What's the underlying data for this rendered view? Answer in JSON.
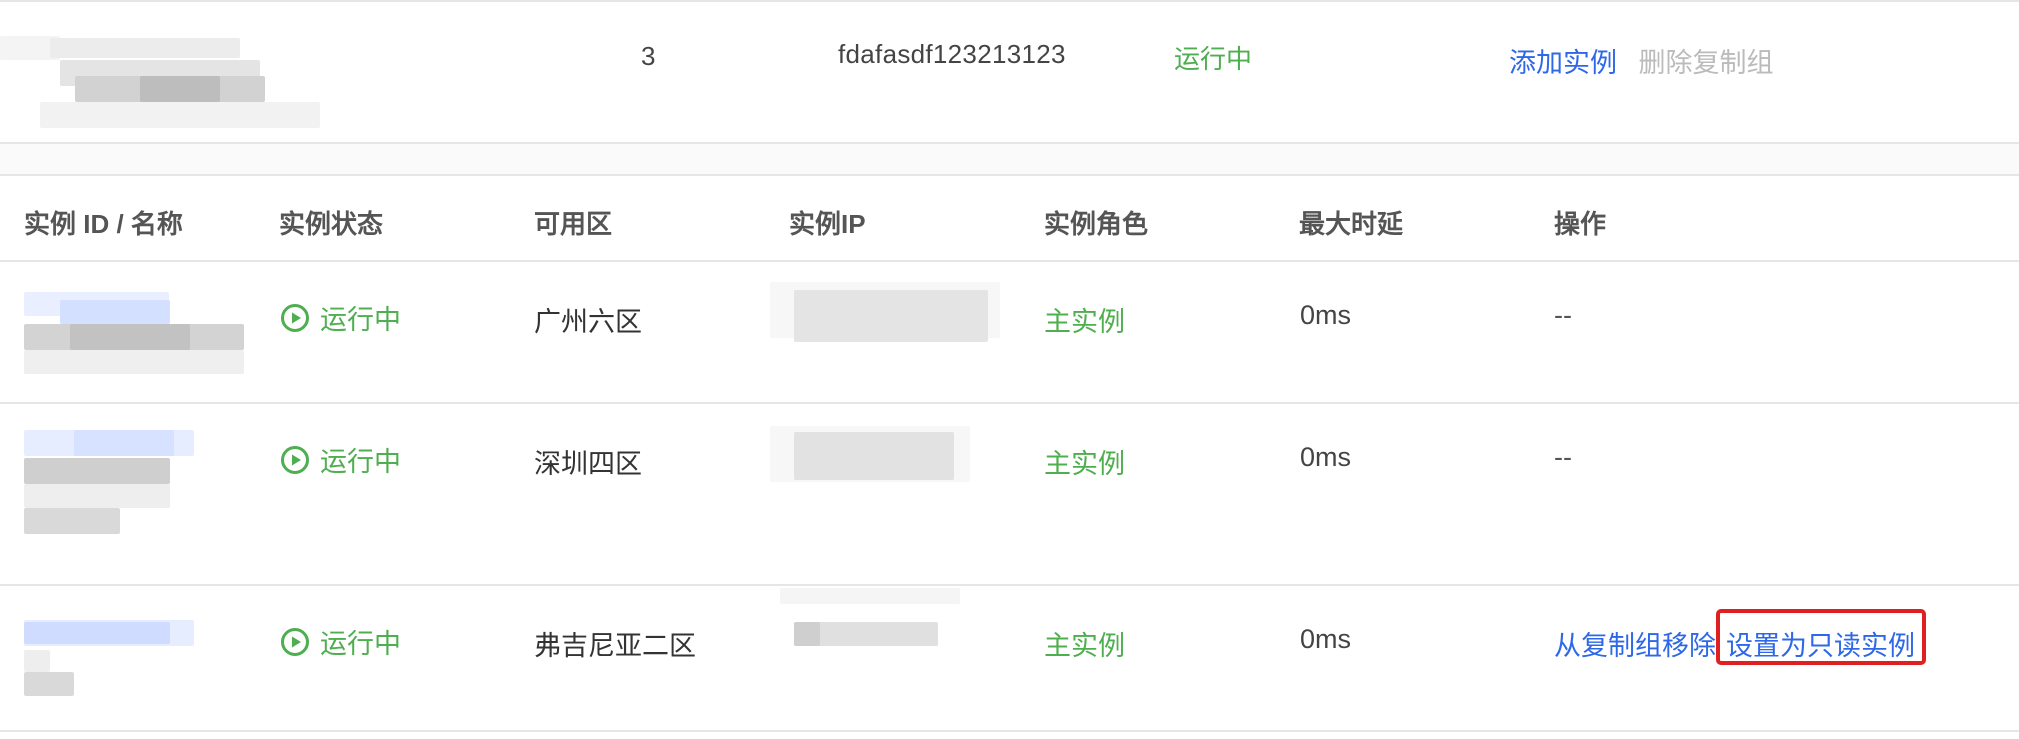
{
  "group": {
    "count": "3",
    "id": "fdafasdf123213123",
    "status": "运行中",
    "actions": {
      "add": "添加实例",
      "delete": "删除复制组"
    }
  },
  "table": {
    "headers": [
      "实例 ID / 名称",
      "实例状态",
      "可用区",
      "实例IP",
      "实例角色",
      "最大时延",
      "操作"
    ],
    "rows": [
      {
        "status": "运行中",
        "zone": "广州六区",
        "role": "主实例",
        "latency": "0ms",
        "action_none": "--"
      },
      {
        "status": "运行中",
        "zone": "深圳四区",
        "role": "主实例",
        "latency": "0ms",
        "action_none": "--"
      },
      {
        "status": "运行中",
        "zone": "弗吉尼亚二区",
        "role": "主实例",
        "latency": "0ms",
        "actions": {
          "remove": "从复制组移除",
          "set_readonly": "设置为只读实例"
        }
      }
    ]
  },
  "colors": {
    "link": "#2e68e8",
    "running": "#4fae4f",
    "disabled": "#bbbbbb",
    "highlight": "#e02020",
    "border": "#e6e6e6"
  },
  "icons": {
    "status": "play-circle-icon"
  }
}
